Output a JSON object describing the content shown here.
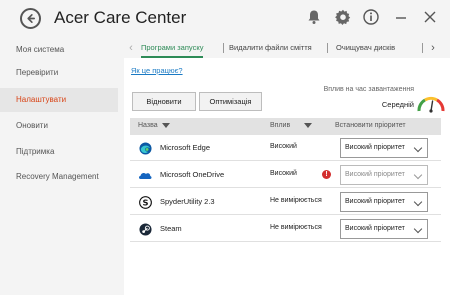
{
  "app": {
    "title": "Acer Care Center"
  },
  "titlebar": {
    "icons": [
      "back-icon",
      "bell-icon",
      "gear-icon",
      "info-icon",
      "minimize-icon",
      "close-icon"
    ]
  },
  "sidebar": {
    "items": [
      {
        "label": "Моя система",
        "active": false
      },
      {
        "label": "Перевірити",
        "active": false
      },
      {
        "label": "Налаштувати",
        "active": true
      },
      {
        "label": "Оновити",
        "active": false
      },
      {
        "label": "Підтримка",
        "active": false
      },
      {
        "label": "Recovery Management",
        "active": false
      }
    ]
  },
  "tabs": [
    {
      "label": "Програми запуску",
      "active": true
    },
    {
      "label": "Видалити файли сміття",
      "active": false
    },
    {
      "label": "Очищувач дисків",
      "active": false
    }
  ],
  "content": {
    "howto_link": "Як це працює?",
    "restore_button": "Відновити",
    "optimize_button": "Оптимізація",
    "impact_label": "Вплив на час завантаження",
    "impact_value": "Середній",
    "gauge_level": 0.55
  },
  "table": {
    "headers": {
      "name": "Назва",
      "impact": "Вплив",
      "priority": "Встановити пріоритет"
    },
    "rows": [
      {
        "icon": "edge-icon",
        "name": "Microsoft Edge",
        "impact": "Високий",
        "warning": false,
        "priority": "Високий пріоритет",
        "disabled": false
      },
      {
        "icon": "onedrive-icon",
        "name": "Microsoft OneDrive",
        "impact": "Високий",
        "warning": true,
        "priority": "Високий пріоритет",
        "disabled": true
      },
      {
        "icon": "spyder-icon",
        "name": "SpyderUtility 2.3",
        "impact": "Не вимірюється",
        "warning": false,
        "priority": "Високий пріоритет",
        "disabled": false
      },
      {
        "icon": "steam-icon",
        "name": "Steam",
        "impact": "Не вимірюється",
        "warning": false,
        "priority": "Високий пріоритет",
        "disabled": false
      }
    ]
  },
  "colors": {
    "accent_sidebar": "#d84315",
    "accent_tab": "#2e8b57",
    "link": "#1a7ac4",
    "warning": "#d32f2f"
  }
}
